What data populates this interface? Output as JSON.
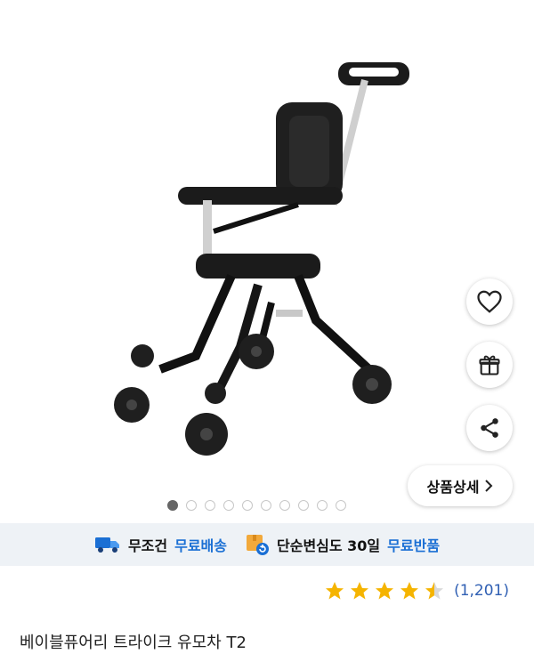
{
  "product": {
    "title": "베이블퓨어리 트라이크 유모차 T2",
    "rating_value": 4.5,
    "rating_count": "(1,201)"
  },
  "gallery": {
    "total_images": 10,
    "active_index": 0
  },
  "actions": {
    "detail_label": "상품상세"
  },
  "shipping": {
    "free_delivery_prefix": "무조건",
    "free_delivery_highlight": "무료배송",
    "return_prefix": "단순변심도 30일",
    "return_highlight": "무료반품"
  },
  "colors": {
    "accent": "#1a6fd4",
    "star": "#f5b400",
    "banner_bg": "#eef2f6"
  }
}
